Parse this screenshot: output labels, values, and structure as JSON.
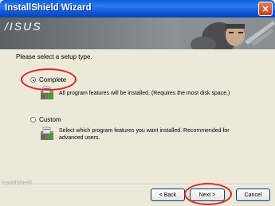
{
  "window": {
    "title": "InstallShield Wizard",
    "close_glyph": "✕"
  },
  "banner": {
    "logo": "/ISUS"
  },
  "subtitle": "Please select a setup type.",
  "options": [
    {
      "label": "Complete",
      "description": "All program features will be installed. (Requires the most disk space.)",
      "selected": true,
      "icon": "install-package-icon"
    },
    {
      "label": "Custom",
      "description": "Select which program features you want installed. Recommended for advanced users.",
      "selected": false,
      "icon": "install-package-icon"
    }
  ],
  "footer": {
    "brand": "InstallShield"
  },
  "buttons": {
    "back": "< Back",
    "next": "Next >",
    "cancel": "Cancel"
  },
  "colors": {
    "highlight": "#e32020",
    "titlebar": "#0a5fd8"
  }
}
